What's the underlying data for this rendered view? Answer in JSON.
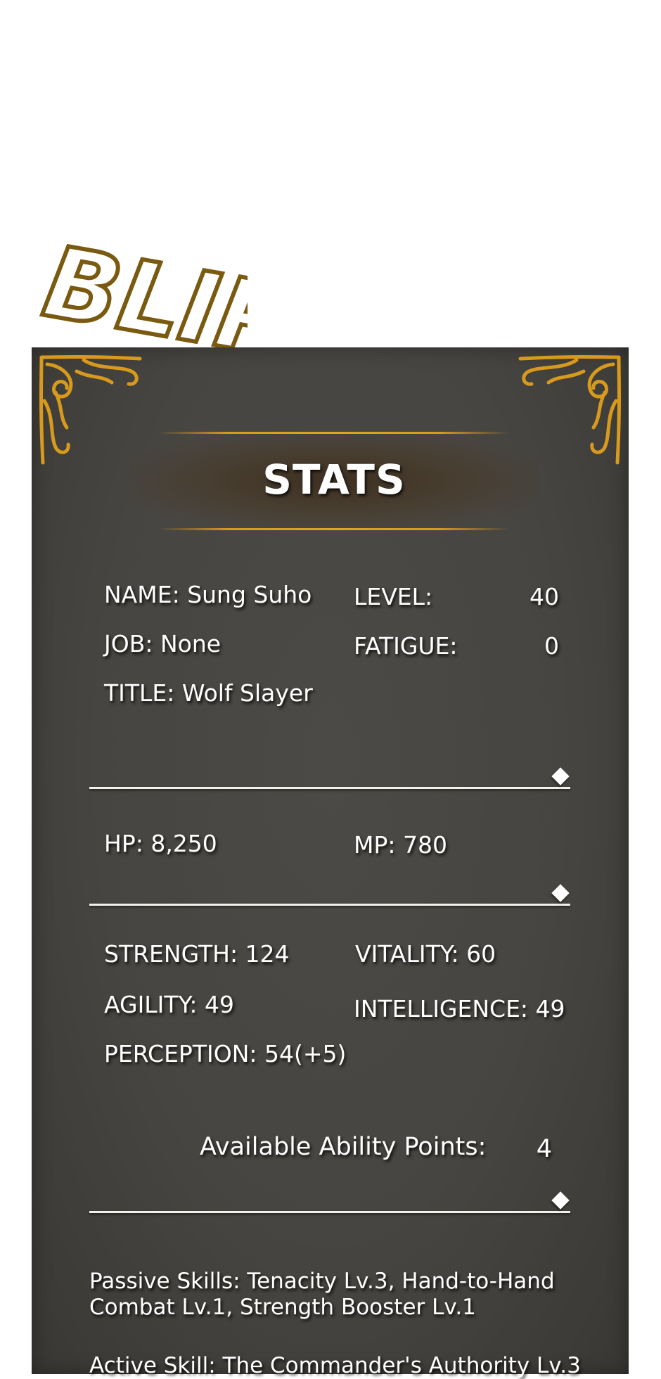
{
  "sfx": {
    "text": "BLIP"
  },
  "header": {
    "title": "STATS"
  },
  "profile": {
    "name": "NAME: Sung Suho",
    "job": "JOB: None",
    "title": "TITLE: Wolf Slayer",
    "level_label": "LEVEL:",
    "level_value": "40",
    "fatigue_label": "FATIGUE:",
    "fatigue_value": "0"
  },
  "vitals": {
    "hp": "HP: 8,250",
    "mp": "MP: 780"
  },
  "attributes": {
    "strength": "STRENGTH: 124",
    "vitality": "VITALITY: 60",
    "agility": "AGILITY: 49",
    "intelligence": "INTELLIGENCE: 49",
    "perception": "PERCEPTION: 54(+5)"
  },
  "ability_points": {
    "label": "Available Ability Points:",
    "value": "4"
  },
  "skills": {
    "passive": "Passive Skills: Tenacity Lv.3, Hand-to-Hand Combat Lv.1, Strength Booster Lv.1",
    "active": "Active Skill: The Commander's Authority Lv.3"
  },
  "colors": {
    "panel": "#474541",
    "gold": "#d79a1c",
    "sfx_outline": "#7a5a10"
  }
}
